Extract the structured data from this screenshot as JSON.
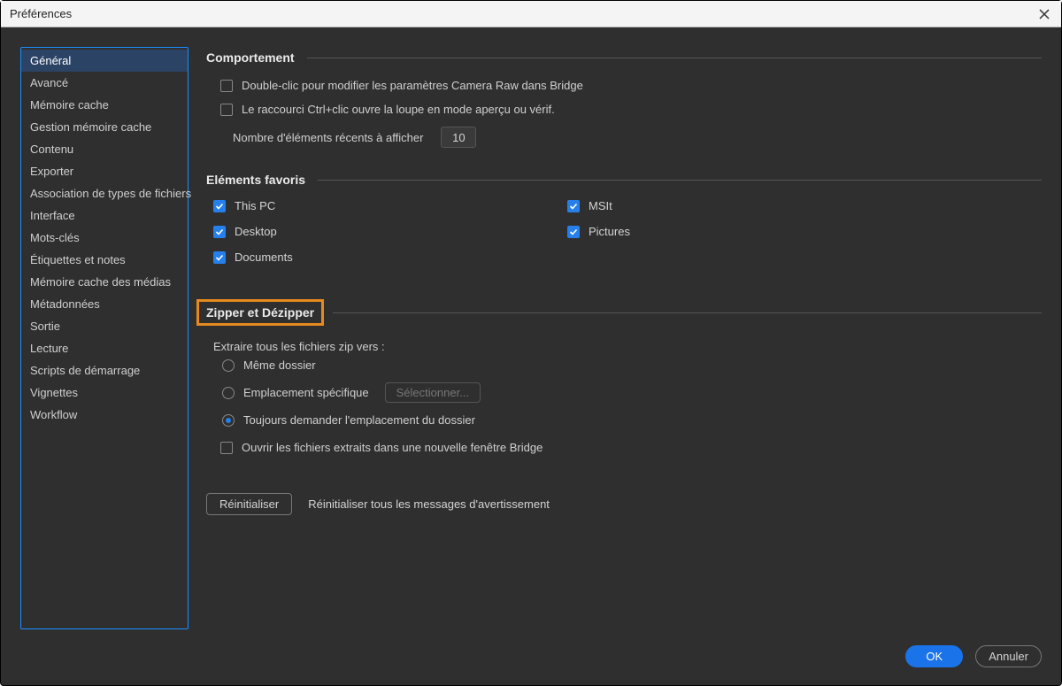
{
  "window": {
    "title": "Préférences"
  },
  "sidebar": {
    "items": [
      "Général",
      "Avancé",
      "Mémoire cache",
      "Gestion mémoire cache",
      "Contenu",
      "Exporter",
      "Association de types de fichiers",
      "Interface",
      "Mots-clés",
      "Étiquettes et notes",
      "Mémoire cache des médias",
      "Métadonnées",
      "Sortie",
      "Lecture",
      "Scripts de démarrage",
      "Vignettes",
      "Workflow"
    ],
    "selected_index": 0
  },
  "sections": {
    "comportement": {
      "title": "Comportement",
      "opt1": "Double-clic pour modifier les paramètres Camera Raw dans Bridge",
      "opt2": "Le raccourci Ctrl+clic ouvre la loupe en mode aperçu ou vérif.",
      "recent_label": "Nombre d'éléments récents à afficher",
      "recent_value": "10"
    },
    "favoris": {
      "title": "Eléments favoris",
      "items": [
        {
          "label": "This PC",
          "checked": true
        },
        {
          "label": "MSIt",
          "checked": true
        },
        {
          "label": "Desktop",
          "checked": true
        },
        {
          "label": "Pictures",
          "checked": true
        },
        {
          "label": "Documents",
          "checked": true
        }
      ]
    },
    "zip": {
      "title": "Zipper et Dézipper",
      "extract_label": "Extraire tous les fichiers zip vers :",
      "r1": "Même dossier",
      "r2": "Emplacement spécifique",
      "r3": "Toujours demander l'emplacement du dossier",
      "select_btn": "Sélectionner...",
      "open_extracted": "Ouvrir les fichiers extraits dans une nouvelle fenêtre Bridge"
    },
    "reset": {
      "button": "Réinitialiser",
      "label": "Réinitialiser tous les messages d'avertissement"
    }
  },
  "footer": {
    "ok": "OK",
    "cancel": "Annuler"
  }
}
